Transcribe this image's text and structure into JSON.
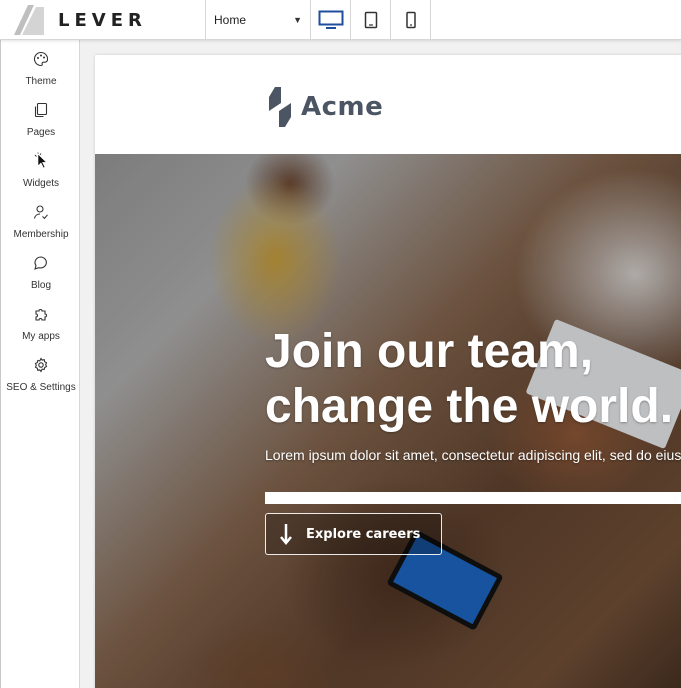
{
  "app": {
    "brand": "LEVER"
  },
  "toolbar": {
    "page_select": {
      "value": "Home"
    },
    "devices": [
      {
        "name": "desktop",
        "icon": "desktop-icon",
        "active": true
      },
      {
        "name": "tablet",
        "icon": "tablet-icon",
        "active": false
      },
      {
        "name": "mobile",
        "icon": "mobile-icon",
        "active": false
      }
    ]
  },
  "sidebar": {
    "items": [
      {
        "label": "Theme",
        "icon": "palette-icon"
      },
      {
        "label": "Pages",
        "icon": "pages-icon"
      },
      {
        "label": "Widgets",
        "icon": "cursor-icon"
      },
      {
        "label": "Membership",
        "icon": "user-icon"
      },
      {
        "label": "Blog",
        "icon": "chat-bubble-icon"
      },
      {
        "label": "My apps",
        "icon": "puzzle-icon"
      },
      {
        "label": "SEO & Settings",
        "icon": "gear-icon"
      }
    ]
  },
  "site": {
    "logo_text": "Acme",
    "hero": {
      "title_line1": "Join our team,",
      "title_line2": "change the world.",
      "subtitle": "Lorem ipsum dolor sit amet, consectetur adipiscing elit, sed do eiusmod te",
      "cta_label": "Explore careers"
    }
  },
  "colors": {
    "accent_blue": "#1f4f9c",
    "logo_gray": "#4b5563",
    "text_dark": "#222222"
  }
}
